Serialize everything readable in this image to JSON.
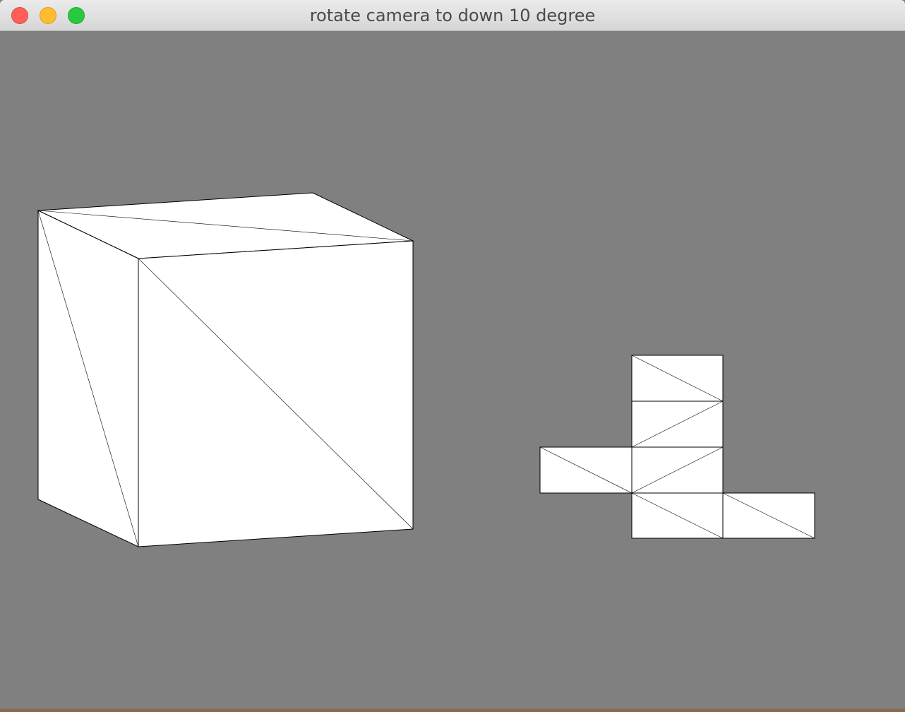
{
  "window": {
    "title": "rotate camera to down 10 degree"
  },
  "colors": {
    "viewport_bg": "#808080",
    "face_fill": "#ffffff",
    "edge": "#000000"
  }
}
